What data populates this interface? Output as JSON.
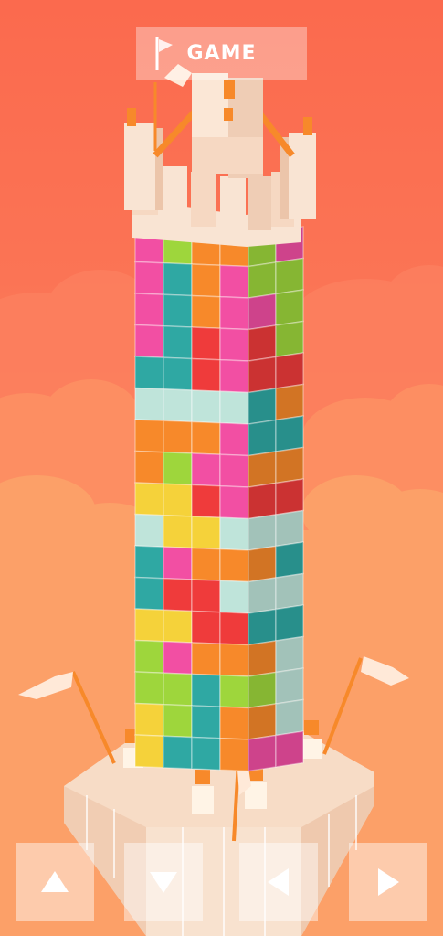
{
  "game": {
    "mode_label": "GAME"
  },
  "controls": {
    "up_icon": "triangle-up",
    "down_icon": "triangle-down",
    "left_icon": "triangle-left",
    "right_icon": "triangle-right"
  },
  "colors": {
    "sky_top": "#fb6a4e",
    "sky_bottom": "#fcaf6c",
    "stone": "#f6d8c2",
    "pink": "#f24fa3",
    "orange": "#f7892a",
    "lime": "#9ed63c",
    "teal": "#2fa8a3",
    "red": "#ef3b3b",
    "yellow": "#f5d23a",
    "glass": "#bfe4da"
  },
  "tower": {
    "rows": [
      [
        "pink",
        "lime",
        "orange",
        "orange",
        "lime",
        "pink"
      ],
      [
        "pink",
        "teal",
        "orange",
        "pink",
        "lime",
        "lime"
      ],
      [
        "pink",
        "teal",
        "orange",
        "pink",
        "pink",
        "lime"
      ],
      [
        "pink",
        "teal",
        "red",
        "pink",
        "red",
        "lime"
      ],
      [
        "teal",
        "teal",
        "red",
        "pink",
        "red",
        "red"
      ],
      [
        "glass",
        "glass",
        "glass",
        "glass",
        "teal",
        "orange"
      ],
      [
        "orange",
        "orange",
        "orange",
        "pink",
        "teal",
        "teal"
      ],
      [
        "orange",
        "lime",
        "pink",
        "pink",
        "orange",
        "orange"
      ],
      [
        "yellow",
        "yellow",
        "red",
        "pink",
        "red",
        "red"
      ],
      [
        "glass",
        "yellow",
        "yellow",
        "glass",
        "glass",
        "glass"
      ],
      [
        "teal",
        "pink",
        "orange",
        "orange",
        "orange",
        "teal"
      ],
      [
        "teal",
        "red",
        "red",
        "glass",
        "glass",
        "glass"
      ],
      [
        "yellow",
        "yellow",
        "red",
        "red",
        "teal",
        "teal"
      ],
      [
        "lime",
        "pink",
        "orange",
        "orange",
        "orange",
        "glass"
      ],
      [
        "lime",
        "lime",
        "teal",
        "lime",
        "lime",
        "glass"
      ],
      [
        "yellow",
        "lime",
        "teal",
        "orange",
        "orange",
        "glass"
      ],
      [
        "yellow",
        "teal",
        "teal",
        "orange",
        "pink",
        "pink"
      ]
    ]
  }
}
